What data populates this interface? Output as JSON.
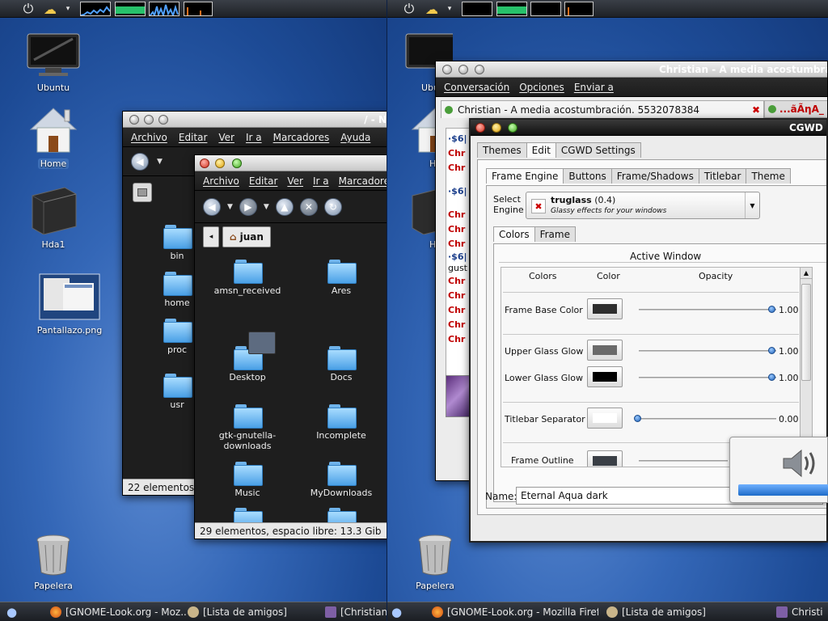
{
  "left_screen": {
    "desktop_icons": [
      {
        "label": "Ubuntu",
        "icon": "monitor-icon"
      },
      {
        "label": "Home",
        "icon": "home-icon"
      },
      {
        "label": "Hda1",
        "icon": "hard-drive-icon"
      },
      {
        "label": "Pantallazo.png",
        "icon": "image-thumbnail-icon"
      },
      {
        "label": "Papelera",
        "icon": "trash-icon"
      }
    ],
    "back_window": {
      "title": "/ - N",
      "menu": [
        "Archivo",
        "Editar",
        "Ver",
        "Ir a",
        "Marcadores",
        "Ayuda"
      ],
      "folders": [
        "bin",
        "home",
        "proc",
        "usr"
      ],
      "status": "22 elementos, "
    },
    "front_window": {
      "menu": [
        "Archivo",
        "Editar",
        "Ver",
        "Ir a",
        "Marcadores"
      ],
      "location": "juan",
      "items": [
        "amsn_received",
        "Ares",
        "Desktop",
        "Docs",
        "gtk-gnutella-downloads",
        "Incomplete",
        "Music",
        "MyDownloads"
      ],
      "status": "29 elementos, espacio libre: 13.3 Gib"
    },
    "taskbar": [
      "[GNOME-Look.org - Moz...",
      "[Lista de amigos]",
      "[Christian"
    ]
  },
  "right_screen": {
    "desktop_icons": [
      {
        "label": "Ubu",
        "icon": "monitor-icon"
      },
      {
        "label": "Ho",
        "icon": "home-icon"
      },
      {
        "label": "Hd",
        "icon": "hard-drive-icon"
      },
      {
        "label": "Papelera",
        "icon": "trash-icon"
      }
    ],
    "chat_window": {
      "title": "Christian - A media acostumbracio",
      "menu": [
        "Conversación",
        "Opciones",
        "Enviar a"
      ],
      "tab_label": "Christian - A media acostumbración. 5532078384",
      "tab2_label": "...ãÃηA_",
      "lines": [
        {
          "text": "·$6|",
          "color": "#1c3f8c"
        },
        {
          "text": "Chr",
          "color": "#c00000"
        },
        {
          "text": "Chr",
          "color": "#c00000"
        },
        {
          "text": "·$6|",
          "color": "#1c3f8c"
        },
        {
          "text": "Chr",
          "color": "#c00000"
        },
        {
          "text": "Chr",
          "color": "#c00000"
        },
        {
          "text": "Chr",
          "color": "#c00000"
        },
        {
          "text": "·$6|",
          "color": "#1c3f8c"
        },
        {
          "text": "gust",
          "color": "#111111"
        },
        {
          "text": "Chr",
          "color": "#c00000"
        },
        {
          "text": "Chr",
          "color": "#c00000"
        },
        {
          "text": "Chr",
          "color": "#c00000"
        },
        {
          "text": "Chr",
          "color": "#c00000"
        },
        {
          "text": "Chr",
          "color": "#c00000"
        }
      ]
    },
    "cgwd_window": {
      "title": "CGWD T",
      "top_tabs": [
        "Themes",
        "Edit",
        "CGWD Settings"
      ],
      "sub_tabs": [
        "Frame Engine",
        "Buttons",
        "Frame/Shadows",
        "Titlebar",
        "Theme"
      ],
      "select_label": "Select Engine",
      "engine_name": "truglass",
      "engine_version": "(0.4)",
      "engine_desc": "Glassy effects for your windows",
      "inner_tabs": [
        "Colors",
        "Frame"
      ],
      "section_title": "Active Window",
      "col_headers": [
        "Colors",
        "Color",
        "Opacity"
      ],
      "rows": [
        {
          "label": "Frame Base Color",
          "color": "#2e2e2e",
          "opacity": "1.00",
          "level": 1.0
        },
        {
          "label": "Upper Glass Glow",
          "color": "#6a6a6a",
          "opacity": "1.00",
          "level": 1.0
        },
        {
          "label": "Lower Glass Glow",
          "color": "#000000",
          "opacity": "1.00",
          "level": 1.0
        },
        {
          "label": "Titlebar Separator",
          "color": "#ffffff",
          "opacity": "0.00",
          "level": 0.0
        },
        {
          "label": "Frame Outline",
          "color": "#3a3f46",
          "opacity": "",
          "level": 0.0
        }
      ],
      "name_label": "Name:",
      "name_value": "Eternal Aqua dark"
    },
    "volume_osd": {
      "icon": "speaker-icon",
      "level": 1.0
    },
    "taskbar": [
      "[GNOME-Look.org - Mozilla Firef...",
      "[Lista de amigos]",
      "Christi"
    ]
  }
}
